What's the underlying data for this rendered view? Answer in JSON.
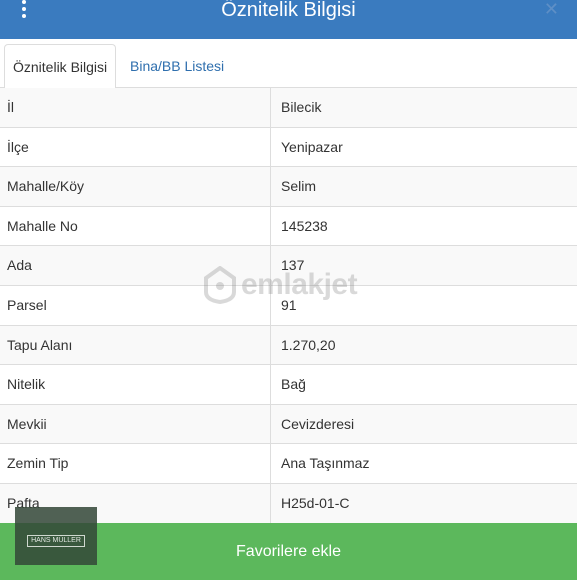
{
  "header": {
    "title": "Öznitelik Bilgisi"
  },
  "tabs": [
    {
      "label": "Öznitelik Bilgisi",
      "active": true
    },
    {
      "label": "Bina/BB Listesi",
      "active": false
    }
  ],
  "attributes": [
    {
      "key": "İl",
      "value": "Bilecik"
    },
    {
      "key": "İlçe",
      "value": "Yenipazar"
    },
    {
      "key": "Mahalle/Köy",
      "value": "Selim"
    },
    {
      "key": "Mahalle No",
      "value": "145238"
    },
    {
      "key": "Ada",
      "value": "137"
    },
    {
      "key": "Parsel",
      "value": "91"
    },
    {
      "key": "Tapu Alanı",
      "value": "1.270,20"
    },
    {
      "key": "Nitelik",
      "value": "Bağ"
    },
    {
      "key": "Mevkii",
      "value": "Cevizderesi"
    },
    {
      "key": "Zemin Tip",
      "value": "Ana Taşınmaz"
    },
    {
      "key": "Pafta",
      "value": "H25d-01-C"
    }
  ],
  "watermark": {
    "text": "emlakjet"
  },
  "footer": {
    "favorite_label": "Favorilere ekle"
  },
  "corner_logo": {
    "text": "HANS MÜLLER"
  },
  "colors": {
    "header": "#3a7bbf",
    "tab_link": "#2f6fae",
    "favorite_bar": "#5cb85c"
  }
}
